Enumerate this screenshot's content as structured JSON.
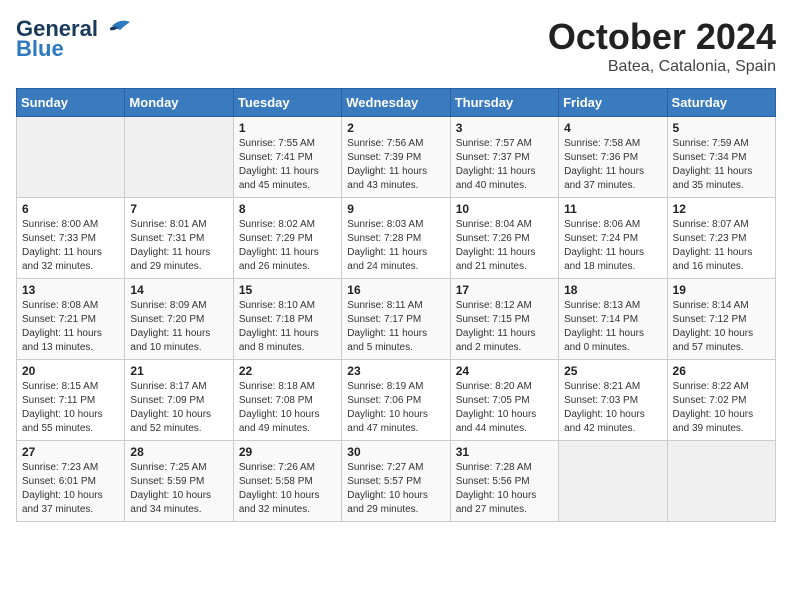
{
  "header": {
    "logo_general": "General",
    "logo_blue": "Blue",
    "month": "October 2024",
    "location": "Batea, Catalonia, Spain"
  },
  "days_of_week": [
    "Sunday",
    "Monday",
    "Tuesday",
    "Wednesday",
    "Thursday",
    "Friday",
    "Saturday"
  ],
  "weeks": [
    [
      {
        "day": "",
        "info": ""
      },
      {
        "day": "",
        "info": ""
      },
      {
        "day": "1",
        "info": "Sunrise: 7:55 AM\nSunset: 7:41 PM\nDaylight: 11 hours and 45 minutes."
      },
      {
        "day": "2",
        "info": "Sunrise: 7:56 AM\nSunset: 7:39 PM\nDaylight: 11 hours and 43 minutes."
      },
      {
        "day": "3",
        "info": "Sunrise: 7:57 AM\nSunset: 7:37 PM\nDaylight: 11 hours and 40 minutes."
      },
      {
        "day": "4",
        "info": "Sunrise: 7:58 AM\nSunset: 7:36 PM\nDaylight: 11 hours and 37 minutes."
      },
      {
        "day": "5",
        "info": "Sunrise: 7:59 AM\nSunset: 7:34 PM\nDaylight: 11 hours and 35 minutes."
      }
    ],
    [
      {
        "day": "6",
        "info": "Sunrise: 8:00 AM\nSunset: 7:33 PM\nDaylight: 11 hours and 32 minutes."
      },
      {
        "day": "7",
        "info": "Sunrise: 8:01 AM\nSunset: 7:31 PM\nDaylight: 11 hours and 29 minutes."
      },
      {
        "day": "8",
        "info": "Sunrise: 8:02 AM\nSunset: 7:29 PM\nDaylight: 11 hours and 26 minutes."
      },
      {
        "day": "9",
        "info": "Sunrise: 8:03 AM\nSunset: 7:28 PM\nDaylight: 11 hours and 24 minutes."
      },
      {
        "day": "10",
        "info": "Sunrise: 8:04 AM\nSunset: 7:26 PM\nDaylight: 11 hours and 21 minutes."
      },
      {
        "day": "11",
        "info": "Sunrise: 8:06 AM\nSunset: 7:24 PM\nDaylight: 11 hours and 18 minutes."
      },
      {
        "day": "12",
        "info": "Sunrise: 8:07 AM\nSunset: 7:23 PM\nDaylight: 11 hours and 16 minutes."
      }
    ],
    [
      {
        "day": "13",
        "info": "Sunrise: 8:08 AM\nSunset: 7:21 PM\nDaylight: 11 hours and 13 minutes."
      },
      {
        "day": "14",
        "info": "Sunrise: 8:09 AM\nSunset: 7:20 PM\nDaylight: 11 hours and 10 minutes."
      },
      {
        "day": "15",
        "info": "Sunrise: 8:10 AM\nSunset: 7:18 PM\nDaylight: 11 hours and 8 minutes."
      },
      {
        "day": "16",
        "info": "Sunrise: 8:11 AM\nSunset: 7:17 PM\nDaylight: 11 hours and 5 minutes."
      },
      {
        "day": "17",
        "info": "Sunrise: 8:12 AM\nSunset: 7:15 PM\nDaylight: 11 hours and 2 minutes."
      },
      {
        "day": "18",
        "info": "Sunrise: 8:13 AM\nSunset: 7:14 PM\nDaylight: 11 hours and 0 minutes."
      },
      {
        "day": "19",
        "info": "Sunrise: 8:14 AM\nSunset: 7:12 PM\nDaylight: 10 hours and 57 minutes."
      }
    ],
    [
      {
        "day": "20",
        "info": "Sunrise: 8:15 AM\nSunset: 7:11 PM\nDaylight: 10 hours and 55 minutes."
      },
      {
        "day": "21",
        "info": "Sunrise: 8:17 AM\nSunset: 7:09 PM\nDaylight: 10 hours and 52 minutes."
      },
      {
        "day": "22",
        "info": "Sunrise: 8:18 AM\nSunset: 7:08 PM\nDaylight: 10 hours and 49 minutes."
      },
      {
        "day": "23",
        "info": "Sunrise: 8:19 AM\nSunset: 7:06 PM\nDaylight: 10 hours and 47 minutes."
      },
      {
        "day": "24",
        "info": "Sunrise: 8:20 AM\nSunset: 7:05 PM\nDaylight: 10 hours and 44 minutes."
      },
      {
        "day": "25",
        "info": "Sunrise: 8:21 AM\nSunset: 7:03 PM\nDaylight: 10 hours and 42 minutes."
      },
      {
        "day": "26",
        "info": "Sunrise: 8:22 AM\nSunset: 7:02 PM\nDaylight: 10 hours and 39 minutes."
      }
    ],
    [
      {
        "day": "27",
        "info": "Sunrise: 7:23 AM\nSunset: 6:01 PM\nDaylight: 10 hours and 37 minutes."
      },
      {
        "day": "28",
        "info": "Sunrise: 7:25 AM\nSunset: 5:59 PM\nDaylight: 10 hours and 34 minutes."
      },
      {
        "day": "29",
        "info": "Sunrise: 7:26 AM\nSunset: 5:58 PM\nDaylight: 10 hours and 32 minutes."
      },
      {
        "day": "30",
        "info": "Sunrise: 7:27 AM\nSunset: 5:57 PM\nDaylight: 10 hours and 29 minutes."
      },
      {
        "day": "31",
        "info": "Sunrise: 7:28 AM\nSunset: 5:56 PM\nDaylight: 10 hours and 27 minutes."
      },
      {
        "day": "",
        "info": ""
      },
      {
        "day": "",
        "info": ""
      }
    ]
  ]
}
